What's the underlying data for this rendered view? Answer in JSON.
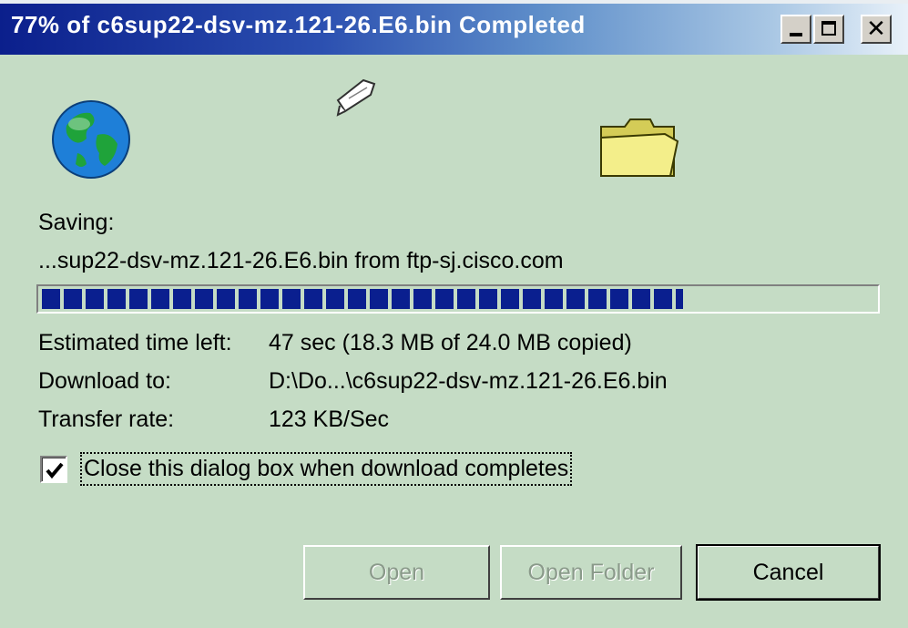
{
  "window": {
    "title": "77% of c6sup22-dsv-mz.121-26.E6.bin Completed",
    "buttons": {
      "minimize": "minimize-icon",
      "maximize": "maximize-icon",
      "close": "close-icon"
    }
  },
  "icons": [
    "globe-icon",
    "document-icon",
    "folder-icon"
  ],
  "saving": {
    "label": "Saving:",
    "file": "...sup22-dsv-mz.121-26.E6.bin from ftp-sj.cisco.com"
  },
  "progress": {
    "fraction": 0.77,
    "color": "#0a1f8f"
  },
  "details": {
    "time_left_label": "Estimated time left:",
    "time_left_value": "47 sec (18.3 MB of 24.0 MB copied)",
    "download_to_label": "Download to:",
    "download_to_value": "D:\\Do...\\c6sup22-dsv-mz.121-26.E6.bin",
    "transfer_rate_label": "Transfer rate:",
    "transfer_rate_value": "123 KB/Sec"
  },
  "close_on_complete": {
    "checked": true,
    "label": "Close this dialog box when download completes"
  },
  "buttons": {
    "open": "Open",
    "open_folder": "Open Folder",
    "cancel": "Cancel"
  }
}
